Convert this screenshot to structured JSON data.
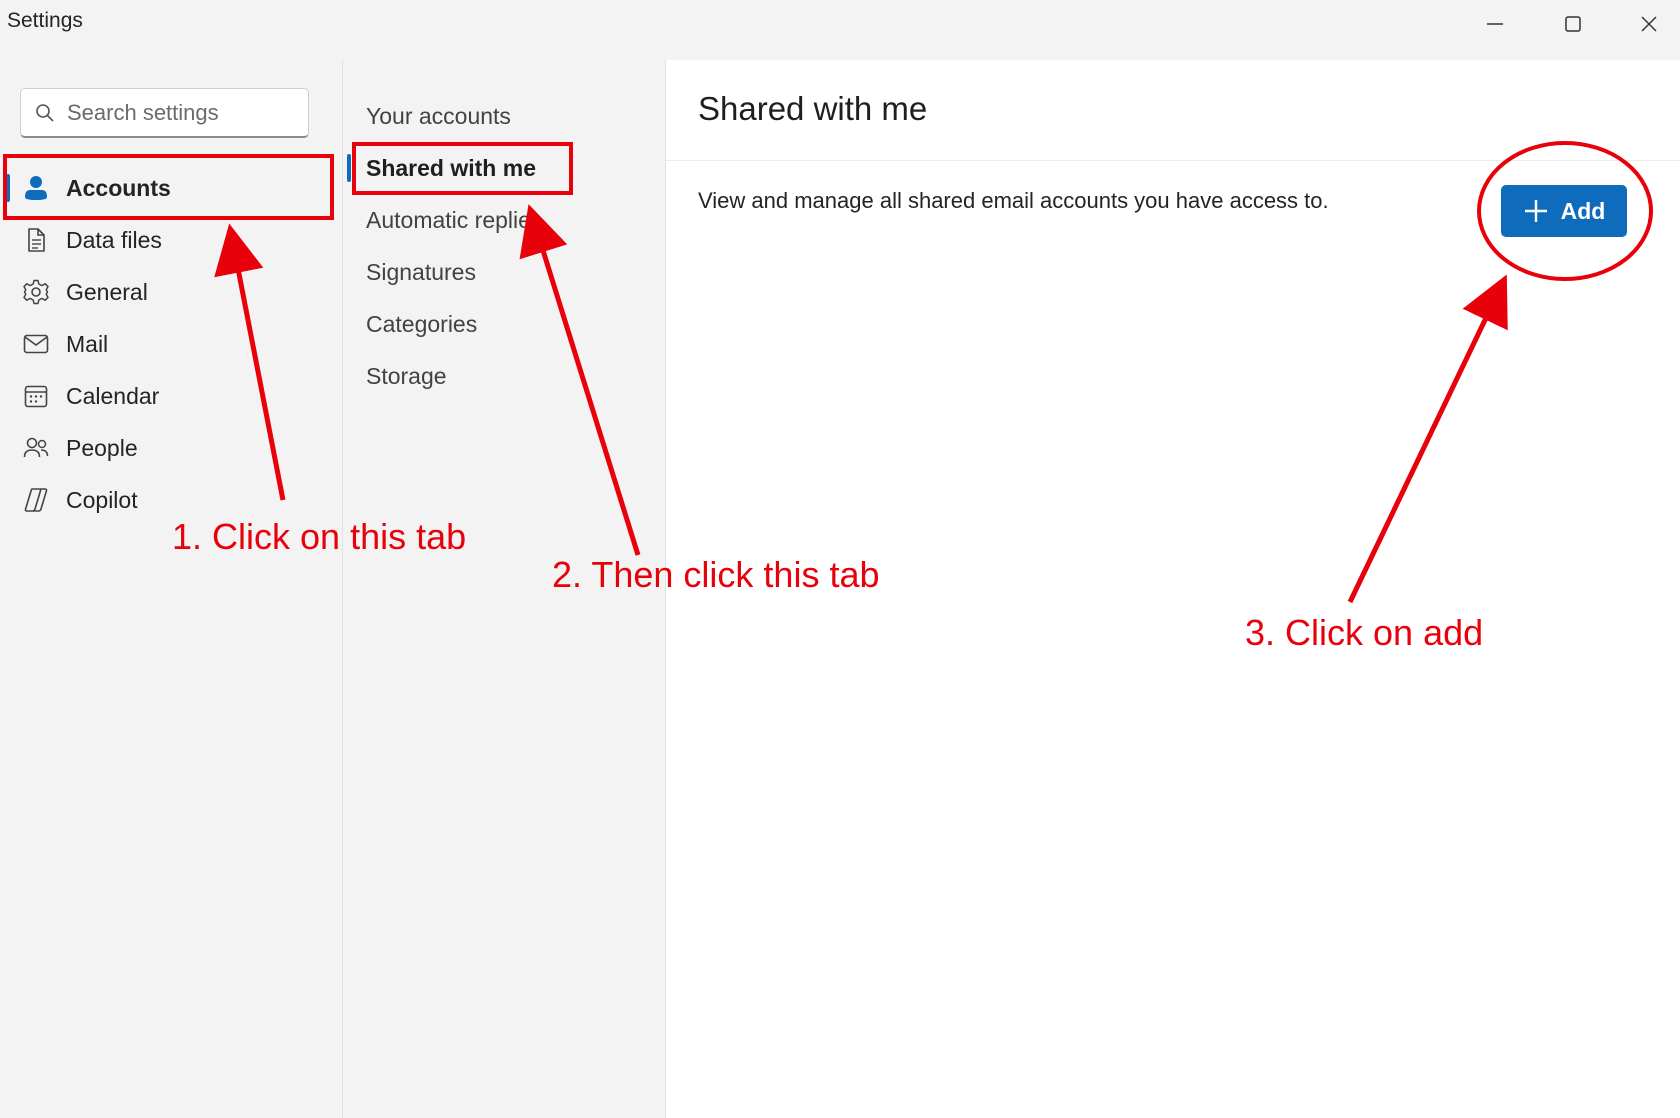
{
  "window": {
    "title": "Settings"
  },
  "search": {
    "placeholder": "Search settings"
  },
  "nav": {
    "items": [
      {
        "label": "Accounts",
        "icon": "person-icon",
        "active": true
      },
      {
        "label": "Data files",
        "icon": "document-icon"
      },
      {
        "label": "General",
        "icon": "gear-icon"
      },
      {
        "label": "Mail",
        "icon": "mail-icon"
      },
      {
        "label": "Calendar",
        "icon": "calendar-icon"
      },
      {
        "label": "People",
        "icon": "people-icon"
      },
      {
        "label": "Copilot",
        "icon": "copilot-icon"
      }
    ]
  },
  "subnav": {
    "items": [
      {
        "label": "Your accounts"
      },
      {
        "label": "Shared with me",
        "active": true
      },
      {
        "label": "Automatic replies"
      },
      {
        "label": "Signatures"
      },
      {
        "label": "Categories"
      },
      {
        "label": "Storage"
      }
    ]
  },
  "content": {
    "title": "Shared with me",
    "description": "View and manage all shared email accounts you have access to.",
    "add_label": "Add"
  },
  "annotations": {
    "step1": "1. Click on this tab",
    "step2": "2. Then click this tab",
    "step3": "3. Click on add"
  },
  "colors": {
    "accent": "#0f6cbd",
    "annotation": "#e8000b"
  }
}
